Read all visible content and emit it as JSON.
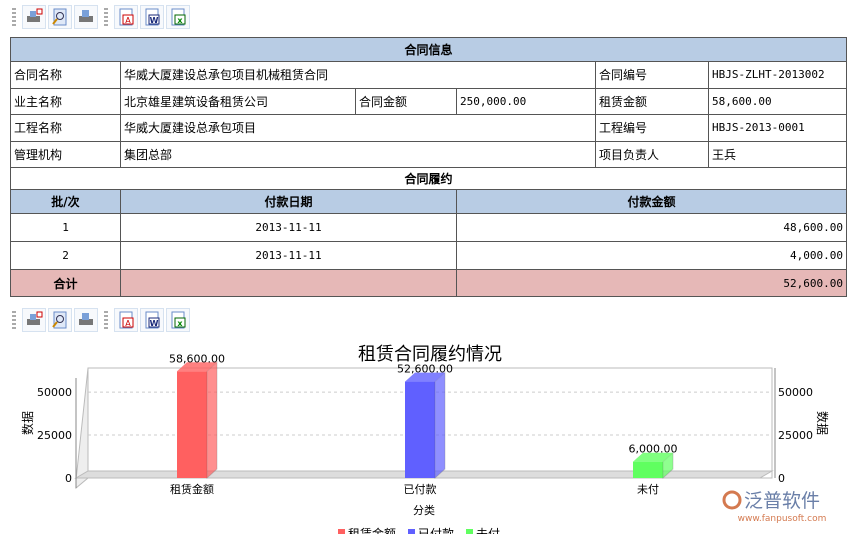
{
  "toolbar_icons": [
    "print-setup-icon",
    "print-preview-icon",
    "print-icon",
    "export-pdf-icon",
    "export-word-icon",
    "export-excel-icon"
  ],
  "contract": {
    "section_title": "合同信息",
    "name_label": "合同名称",
    "name": "华威大厦建设总承包项目机械租赁合同",
    "no_label": "合同编号",
    "no": "HBJS-ZLHT-2013002",
    "owner_label": "业主名称",
    "owner": "北京雄星建筑设备租赁公司",
    "amount_label": "合同金额",
    "amount": "250,000.00",
    "rent_label": "租赁金额",
    "rent": "58,600.00",
    "project_label": "工程名称",
    "project": "华威大厦建设总承包项目",
    "project_no_label": "工程编号",
    "project_no": "HBJS-2013-0001",
    "org_label": "管理机构",
    "org": "集团总部",
    "manager_label": "项目负责人",
    "manager": "王兵"
  },
  "performance": {
    "section_title": "合同履约",
    "headers": [
      "批/次",
      "付款日期",
      "付款金额"
    ],
    "rows": [
      {
        "batch": "1",
        "date": "2013-11-11",
        "amount": "48,600.00"
      },
      {
        "batch": "2",
        "date": "2013-11-11",
        "amount": "4,000.00"
      }
    ],
    "total_label": "合计",
    "total": "52,600.00"
  },
  "chart_data": {
    "type": "bar",
    "title": "租赁合同履约情况",
    "xlabel": "分类",
    "ylabel": "数据",
    "y2label": "数据",
    "categories": [
      "租赁金额",
      "已付款",
      "未付"
    ],
    "values": [
      58600,
      52600,
      6000
    ],
    "value_labels": [
      "58,600.00",
      "52,600.00",
      "6,000.00"
    ],
    "colors": [
      "#ff6060",
      "#6060ff",
      "#60ff60"
    ],
    "yticks": [
      0,
      25000,
      50000
    ],
    "ylim": [
      0,
      64000
    ],
    "grid": true,
    "legend": [
      "租赁金额",
      "已付款",
      "未付"
    ],
    "legend_position": "bottom"
  },
  "watermark": {
    "brand": "泛普软件",
    "url": "www.fanpusoft.com"
  }
}
